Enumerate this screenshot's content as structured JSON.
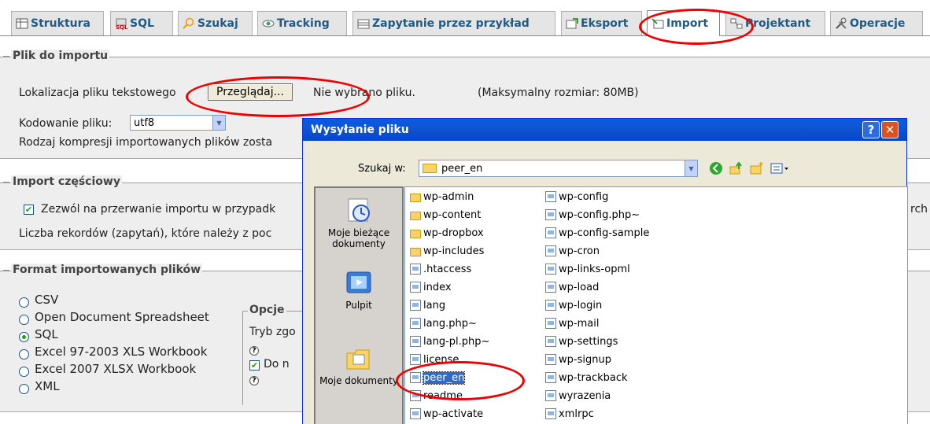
{
  "tabs": [
    {
      "label": "Struktura",
      "icon": "structure-icon"
    },
    {
      "label": "SQL",
      "icon": "sql-icon"
    },
    {
      "label": "Szukaj",
      "icon": "search-icon"
    },
    {
      "label": "Tracking",
      "icon": "eye-icon"
    },
    {
      "label": "Zapytanie przez przykład",
      "icon": "query-icon"
    },
    {
      "label": "Eksport",
      "icon": "export-icon"
    },
    {
      "label": "Import",
      "icon": "import-icon",
      "active": true
    },
    {
      "label": "Projektant",
      "icon": "designer-icon"
    },
    {
      "label": "Operacje",
      "icon": "operations-icon"
    }
  ],
  "plik": {
    "legend": "Plik do importu",
    "location_label": "Lokalizacja pliku tekstowego",
    "browse_button": "Przeglądaj...",
    "no_file": "Nie wybrano pliku.",
    "max_size": "(Maksymalny rozmiar: 80MB)",
    "encoding_label": "Kodowanie pliku:",
    "encoding_value": "utf8",
    "compression_text": "Rodzaj kompresji importowanych plików zosta"
  },
  "partial": {
    "legend": "Import częściowy",
    "allow_interrupt": "Zezwól na przerwanie importu w przypadk",
    "allow_interrupt_tail": "rch p",
    "skip_records": "Liczba rekordów (zapytań), które należy z poc"
  },
  "format": {
    "legend": "Format importowanych plików",
    "options": [
      "CSV",
      "Open Document Spreadsheet",
      "SQL",
      "Excel 97-2003 XLS Workbook",
      "Excel 2007 XLSX Workbook",
      "XML"
    ],
    "selected": "SQL",
    "opcje_legend": "Opcje",
    "tryb_text": "Tryb zgo",
    "do_n_text": "Do n"
  },
  "dialog": {
    "title": "Wysyłanie pliku",
    "help_button": "?",
    "close_button": "✕",
    "lookin_label": "Szukaj w:",
    "lookin_value": "peer_en",
    "places": [
      "Moje bieżące dokumenty",
      "Pulpit",
      "Moje dokumenty"
    ],
    "files_col1": [
      {
        "name": "wp-admin",
        "type": "folder"
      },
      {
        "name": "wp-content",
        "type": "folder"
      },
      {
        "name": "wp-dropbox",
        "type": "folder"
      },
      {
        "name": "wp-includes",
        "type": "folder"
      },
      {
        "name": ".htaccess",
        "type": "file"
      },
      {
        "name": "index",
        "type": "file"
      },
      {
        "name": "lang",
        "type": "file"
      },
      {
        "name": "lang.php~",
        "type": "file"
      },
      {
        "name": "lang-pl.php~",
        "type": "file"
      },
      {
        "name": "license",
        "type": "file"
      },
      {
        "name": "peer_en",
        "type": "file",
        "selected": true
      },
      {
        "name": "readme",
        "type": "file"
      },
      {
        "name": "wp-activate",
        "type": "file"
      }
    ],
    "files_col2": [
      {
        "name": "wp-config",
        "type": "file"
      },
      {
        "name": "wp-config.php~",
        "type": "file"
      },
      {
        "name": "wp-config-sample",
        "type": "file"
      },
      {
        "name": "wp-cron",
        "type": "file"
      },
      {
        "name": "wp-links-opml",
        "type": "file"
      },
      {
        "name": "wp-load",
        "type": "file"
      },
      {
        "name": "wp-login",
        "type": "file"
      },
      {
        "name": "wp-mail",
        "type": "file"
      },
      {
        "name": "wp-settings",
        "type": "file"
      },
      {
        "name": "wp-signup",
        "type": "file"
      },
      {
        "name": "wp-trackback",
        "type": "file"
      },
      {
        "name": "wyrazenia",
        "type": "file"
      },
      {
        "name": "xmlrpc",
        "type": "file"
      }
    ]
  },
  "colors": {
    "tab_text": "#235a81",
    "highlight": "#e00000",
    "title_bar": "#0a5be1"
  }
}
